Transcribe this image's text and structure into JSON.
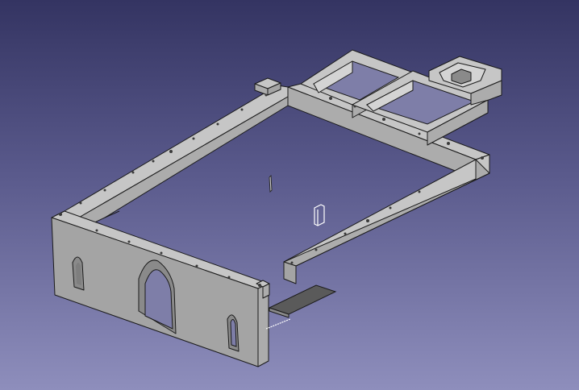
{
  "window": {
    "background_top": "#343462",
    "background_bottom": "#8e8ebc"
  },
  "scene": {
    "model_color": "#c6c6c6",
    "edge_color": "#1a1a1a",
    "selection_color": "#ffffff"
  }
}
